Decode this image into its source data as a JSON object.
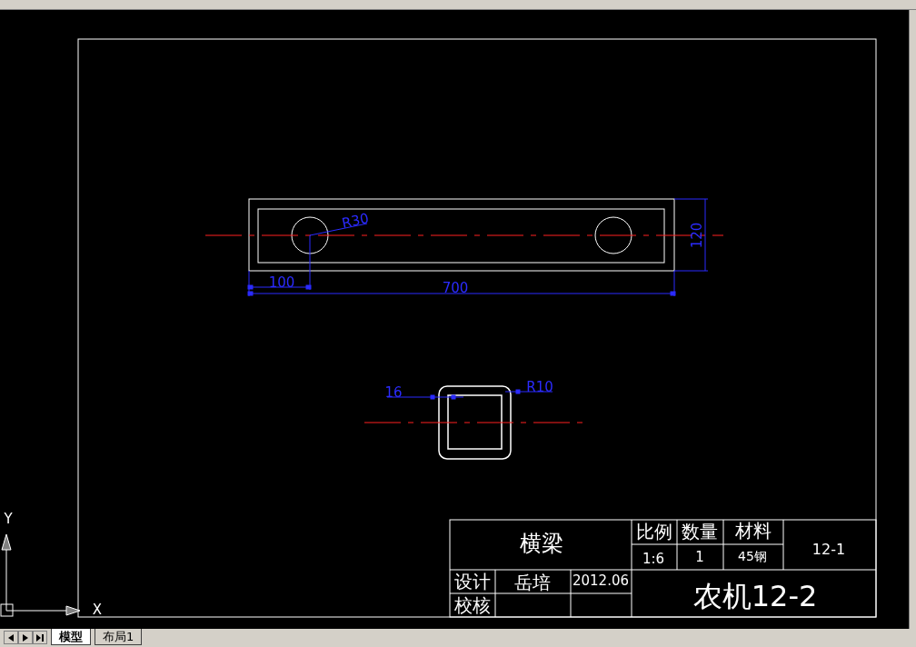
{
  "drawing": {
    "plate": {
      "radius_dim": "R30",
      "height_dim": "120",
      "offset_dim": "100",
      "length_dim": "700"
    },
    "section": {
      "wall_dim": "16",
      "radius_dim": "R10"
    }
  },
  "title_block": {
    "part_name": "横梁",
    "scale_label": "比例",
    "quantity_label": "数量",
    "material_label": "材料",
    "scale": "1:6",
    "quantity": "1",
    "material": "45钢",
    "drawing_number": "12-1",
    "designer_label": "设计",
    "designer": "岳培",
    "date": "2012.06",
    "checker_label": "校核",
    "project": "农机12-2"
  },
  "ucs": {
    "x_label": "X",
    "y_label": "Y"
  },
  "layout_tabs": [
    {
      "label": "模型",
      "selected": true
    },
    {
      "label": "布局1",
      "selected": false
    }
  ]
}
